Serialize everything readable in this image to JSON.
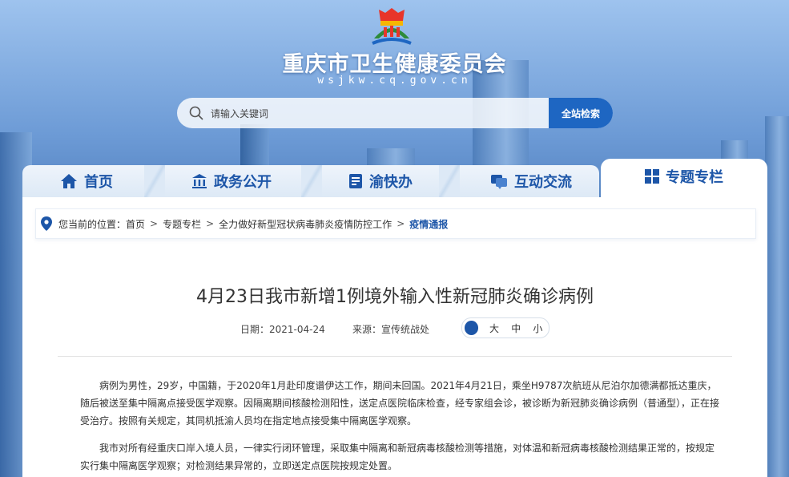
{
  "header": {
    "site_title": "重庆市卫生健康委员会",
    "site_domain": "wsjkw.cq.gov.cn"
  },
  "search": {
    "placeholder": "请输入关键词",
    "button_label": "全站检索"
  },
  "nav": {
    "items": [
      {
        "label": "首页",
        "icon": "home-icon"
      },
      {
        "label": "政务公开",
        "icon": "government-building-icon"
      },
      {
        "label": "渝快办",
        "icon": "document-icon"
      },
      {
        "label": "互动交流",
        "icon": "chat-icon"
      },
      {
        "label": "专题专栏",
        "icon": "grid-icon",
        "active": true
      }
    ]
  },
  "breadcrumb": {
    "prefix": "您当前的位置：",
    "items": [
      "首页",
      "专题专栏",
      "全力做好新型冠状病毒肺炎疫情防控工作",
      "疫情通报"
    ],
    "separator": ">"
  },
  "article": {
    "title": "4月23日我市新增1例境外输入性新冠肺炎确诊病例",
    "date": "日期：2021-04-24",
    "source": "来源：宣传统战处",
    "font_sizes": [
      "大",
      "中",
      "小"
    ],
    "paragraphs": [
      "病例为男性，29岁，中国籍，于2020年1月赴印度谱伊达工作，期间未回国。2021年4月21日，乘坐H9787次航班从尼泊尔加德满都抵达重庆，随后被送至集中隔离点接受医学观察。因隔离期间核酸检测阳性，送定点医院临床检查，经专家组会诊，被诊断为新冠肺炎确诊病例（普通型），正在接受治疗。按照有关规定，其同机抵渝人员均在指定地点接受集中隔离医学观察。",
      "我市对所有经重庆口岸入境人员，一律实行闭环管理，采取集中隔离和新冠病毒核酸检测等措施，对体温和新冠病毒核酸检测结果正常的，按规定实行集中隔离医学观察；对检测结果异常的，立即送定点医院按规定处置。"
    ]
  },
  "colors": {
    "accent": "#1d56a8",
    "search_button": "#1e66c2"
  }
}
